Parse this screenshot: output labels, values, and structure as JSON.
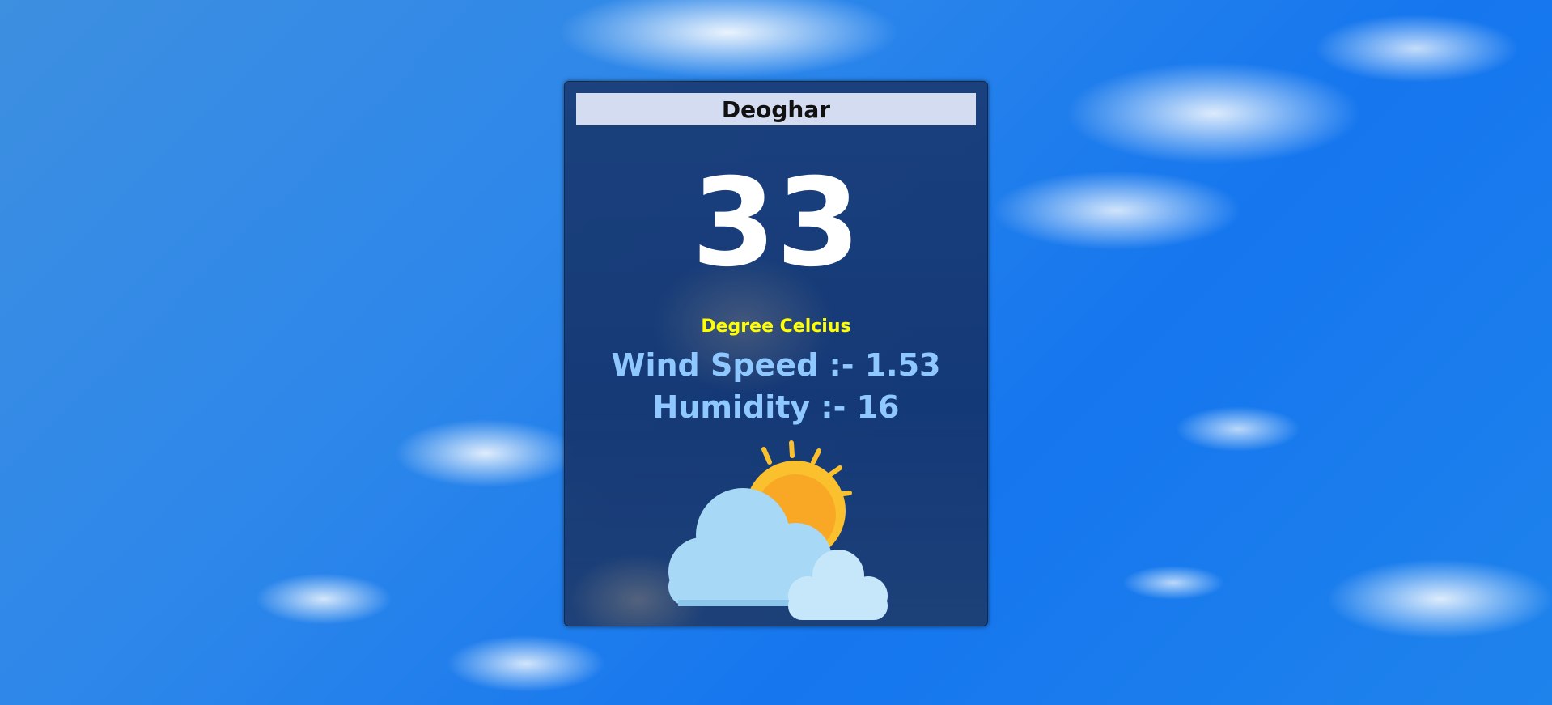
{
  "weather": {
    "city": "Deoghar",
    "temperature": "33",
    "unit_label": "Degree Celcius",
    "wind_speed_text": "Wind Speed :- 1.53",
    "humidity_text": "Humidity :- 16",
    "condition_icon": "partly-cloudy-icon"
  },
  "colors": {
    "unit_label": "#ffff00",
    "stats_text": "#8fc7ff",
    "city_bar": "#d4dcf2",
    "sun": "#fbc02d",
    "cloud": "#a7d8f5"
  }
}
